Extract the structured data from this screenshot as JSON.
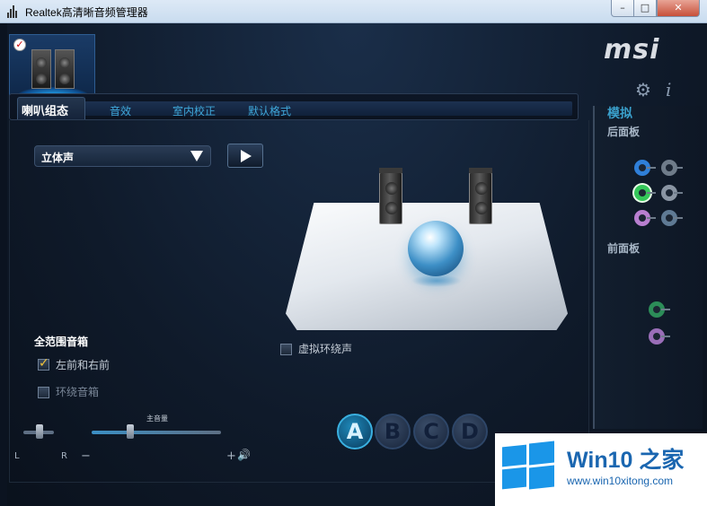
{
  "window": {
    "title": "Realtek高清晰音频管理器",
    "min": "–",
    "max": "□",
    "close": "✕"
  },
  "brand": {
    "logo_text": "msi",
    "gear": "⚙",
    "info": "i"
  },
  "tabs": [
    {
      "label": "喇叭组态",
      "active": true
    },
    {
      "label": "音效"
    },
    {
      "label": "室内校正"
    },
    {
      "label": "默认格式"
    }
  ],
  "speaker_config": {
    "selected": "立体声",
    "full_range_title": "全范围音箱",
    "front_label": "左前和右前",
    "front_checked": true,
    "surround_label": "环绕音箱",
    "surround_checked": false,
    "virtual_surround_label": "虚拟环绕声",
    "virtual_surround_checked": false
  },
  "volume": {
    "title": "主音量",
    "left": "L",
    "right": "R",
    "minus": "−",
    "plus": "+",
    "speaker_icon": "🔊",
    "level_percent": 30
  },
  "profiles": [
    "A",
    "B",
    "C",
    "D"
  ],
  "right_panel": {
    "title": "模拟",
    "rear_label": "后面板",
    "front_label": "前面板",
    "colors": {
      "blue": "#2f7fd8",
      "green": "#34c759",
      "pink": "#b87fd0",
      "gray": "#6f7c8a"
    }
  },
  "watermark": {
    "brand": "Win10 之家",
    "url": "www.win10xitong.com"
  }
}
